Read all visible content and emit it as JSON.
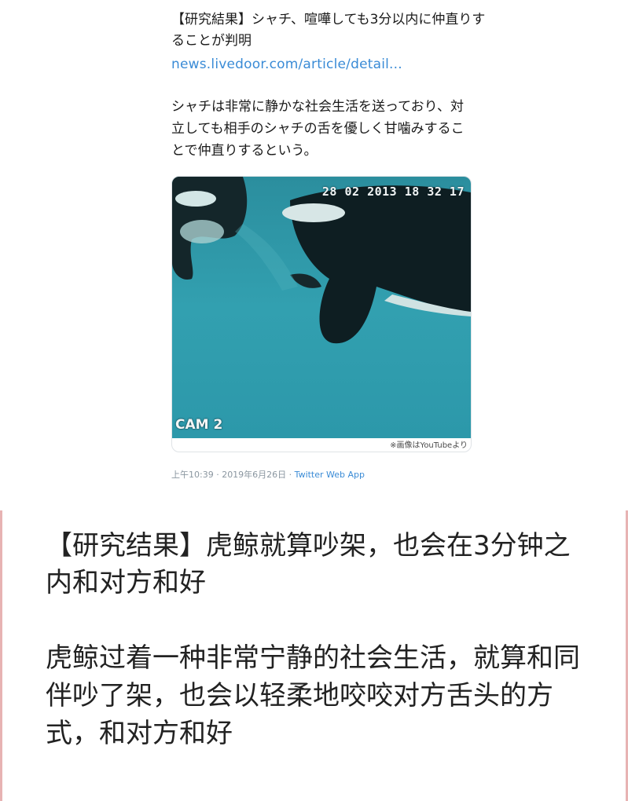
{
  "tweet": {
    "title": "【研究結果】シャチ、喧嘩しても3分以内に仲直りすることが判明",
    "link_text": "news.livedoor.com/article/detail...",
    "body": "シャチは非常に静かな社会生活を送っており、対立しても相手のシャチの舌を優しく甘噛みすることで仲直りするという。",
    "image": {
      "timestamp": "28 02 2013 18 32 17",
      "camera_label": "CAM 2",
      "credit": "※画像はYouTubeより"
    },
    "meta": {
      "time_date": "上午10:39 · 2019年6月26日 · ",
      "source": "Twitter Web App"
    }
  },
  "caption": {
    "title": "【研究结果】虎鲸就算吵架，也会在3分钟之内和对方和好",
    "body": "虎鲸过着一种非常宁静的社会生活，就算和同伴吵了架，也会以轻柔地咬咬对方舌头的方式，和对方和好"
  },
  "colors": {
    "link": "#3a8bd6",
    "water": "#2f97a8",
    "side_border": "#e7b3b3"
  }
}
